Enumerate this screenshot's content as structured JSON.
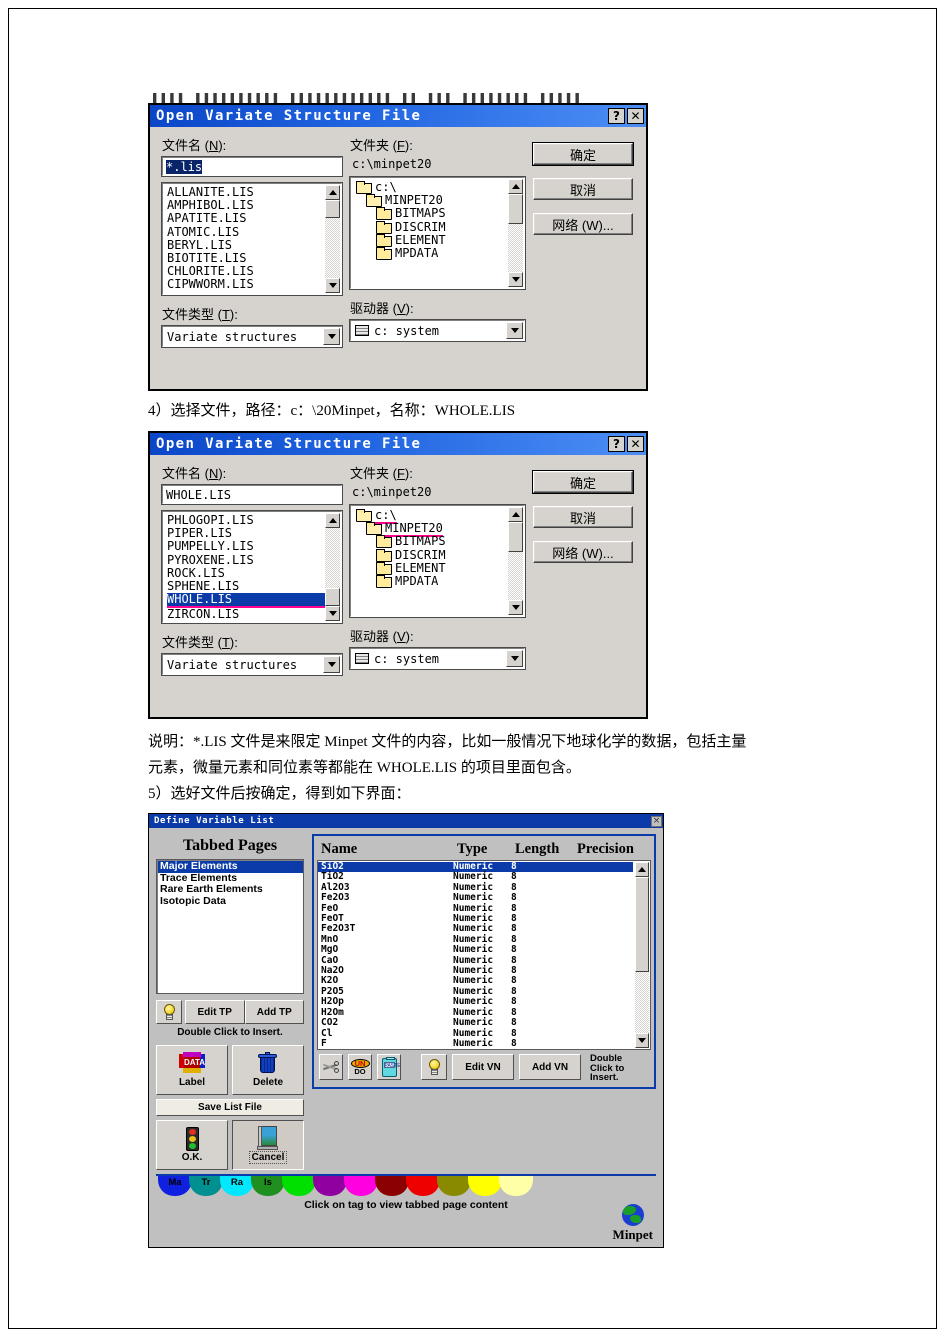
{
  "document": {
    "para_step4": "4）选择文件，路径：c：\\20Minpet，名称：WHOLE.LIS",
    "para_note_line1": "说明：*.LIS 文件是来限定 Minpet 文件的内容，比如一般情况下地球化学的数据，包括主量",
    "para_note_line2": "元素，微量元素和同位素等都能在 WHOLE.LIS 的项目里面包含。",
    "para_step5": "5）选好文件后按确定，得到如下界面："
  },
  "dialog1": {
    "title": "Open Variate Structure File",
    "help_btn": "?",
    "close_btn": "✕",
    "filename_label": "文件名 (N):",
    "filename_mnemonic": "N",
    "filename_value": "*.lis",
    "folder_label": "文件夹 (F):",
    "folder_path": "c:\\minpet20",
    "filetype_label": "文件类型 (T):",
    "filetype_value": "Variate structures",
    "drive_label": "驱动器 (V):",
    "drive_value": "c: system",
    "ok_button": "确定",
    "cancel_button": "取消",
    "network_button": "网络 (W)...",
    "files": [
      "ALLANITE.LIS",
      "AMPHIBOL.LIS",
      "APATITE.LIS",
      "ATOMIC.LIS",
      "BERYL.LIS",
      "BIOTITE.LIS",
      "CHLORITE.LIS",
      "CIPWWORM.LIS"
    ],
    "selected_file": null,
    "folders": [
      {
        "label": "c:\\",
        "indent": 0,
        "type": "open-root",
        "underline": false
      },
      {
        "label": "MINPET20",
        "indent": 1,
        "type": "open",
        "underline": false
      },
      {
        "label": "BITMAPS",
        "indent": 2,
        "type": "closed",
        "underline": false
      },
      {
        "label": "DISCRIM",
        "indent": 2,
        "type": "closed",
        "underline": false
      },
      {
        "label": "ELEMENT",
        "indent": 2,
        "type": "closed",
        "underline": false
      },
      {
        "label": "MPDATA",
        "indent": 2,
        "type": "closed",
        "underline": false
      }
    ]
  },
  "dialog2": {
    "title": "Open Variate Structure File",
    "help_btn": "?",
    "close_btn": "✕",
    "filename_label": "文件名 (N):",
    "filename_value": "WHOLE.LIS",
    "folder_label": "文件夹 (F):",
    "folder_path": "c:\\minpet20",
    "filetype_label": "文件类型 (T):",
    "filetype_value": "Variate structures",
    "drive_label": "驱动器 (V):",
    "drive_value": "c: system",
    "ok_button": "确定",
    "cancel_button": "取消",
    "network_button": "网络 (W)...",
    "files": [
      "PHLOGOPI.LIS",
      "PIPER.LIS",
      "PUMPELLY.LIS",
      "PYROXENE.LIS",
      "ROCK.LIS",
      "SPHENE.LIS",
      "WHOLE.LIS",
      "ZIRCON.LIS"
    ],
    "selected_file": "WHOLE.LIS",
    "folders": [
      {
        "label": "c:\\",
        "indent": 0,
        "type": "open-root",
        "underline": true
      },
      {
        "label": "MINPET20",
        "indent": 1,
        "type": "open",
        "underline": true
      },
      {
        "label": "BITMAPS",
        "indent": 2,
        "type": "closed",
        "underline": false
      },
      {
        "label": "DISCRIM",
        "indent": 2,
        "type": "closed",
        "underline": false
      },
      {
        "label": "ELEMENT",
        "indent": 2,
        "type": "closed",
        "underline": false
      },
      {
        "label": "MPDATA",
        "indent": 2,
        "type": "closed",
        "underline": false
      }
    ]
  },
  "dialog3": {
    "title": "Define Variable List",
    "close_btn": "×",
    "tabbed_pages_heading": "Tabbed Pages",
    "tabbed_pages": [
      "Major Elements",
      "Trace Elements",
      "Rare Earth Elements",
      "Isotopic Data"
    ],
    "selected_tabbed_page": "Major Elements",
    "edit_tp_button": "Edit TP",
    "add_tp_button": "Add TP",
    "tp_hint": "Double Click to Insert.",
    "label_button": "Label",
    "delete_button": "Delete",
    "save_list_file_button": "Save List File",
    "ok_button": "O.K.",
    "cancel_button": "Cancel",
    "grid_headers": {
      "name": "Name",
      "type": "Type",
      "length": "Length",
      "precision": "Precision"
    },
    "variables": [
      {
        "name": "SiO2",
        "type": "Numeric",
        "length": "8",
        "precision": ""
      },
      {
        "name": "TiO2",
        "type": "Numeric",
        "length": "8",
        "precision": ""
      },
      {
        "name": "Al2O3",
        "type": "Numeric",
        "length": "8",
        "precision": ""
      },
      {
        "name": "Fe2O3",
        "type": "Numeric",
        "length": "8",
        "precision": ""
      },
      {
        "name": "FeO",
        "type": "Numeric",
        "length": "8",
        "precision": ""
      },
      {
        "name": "FeOT",
        "type": "Numeric",
        "length": "8",
        "precision": ""
      },
      {
        "name": "Fe2O3T",
        "type": "Numeric",
        "length": "8",
        "precision": ""
      },
      {
        "name": "MnO",
        "type": "Numeric",
        "length": "8",
        "precision": ""
      },
      {
        "name": "MgO",
        "type": "Numeric",
        "length": "8",
        "precision": ""
      },
      {
        "name": "CaO",
        "type": "Numeric",
        "length": "8",
        "precision": ""
      },
      {
        "name": "Na2O",
        "type": "Numeric",
        "length": "8",
        "precision": ""
      },
      {
        "name": "K2O",
        "type": "Numeric",
        "length": "8",
        "precision": ""
      },
      {
        "name": "P2O5",
        "type": "Numeric",
        "length": "8",
        "precision": ""
      },
      {
        "name": "H2Op",
        "type": "Numeric",
        "length": "8",
        "precision": ""
      },
      {
        "name": "H2Om",
        "type": "Numeric",
        "length": "8",
        "precision": ""
      },
      {
        "name": "CO2",
        "type": "Numeric",
        "length": "8",
        "precision": ""
      },
      {
        "name": "Cl",
        "type": "Numeric",
        "length": "8",
        "precision": ""
      },
      {
        "name": "F",
        "type": "Numeric",
        "length": "8",
        "precision": ""
      }
    ],
    "selected_variable": "SiO2",
    "cut_button_icon": "scissors-icon",
    "undo_button_label": "UNDO",
    "paste_button_label": "PASTE",
    "edit_vn_button": "Edit VN",
    "add_vn_button": "Add VN",
    "vn_hint": "Double Click to Insert.",
    "tag_note": "Click on tag to view tabbed page content",
    "brand": "Minpet",
    "tags": [
      {
        "label": "Ma",
        "color": "#1020e0"
      },
      {
        "label": "Tr",
        "color": "#009090"
      },
      {
        "label": "Ra",
        "color": "#00e8ff"
      },
      {
        "label": "Is",
        "color": "#1f9020"
      },
      {
        "label": "",
        "color": "#00e000"
      },
      {
        "label": "",
        "color": "#9000a0"
      },
      {
        "label": "",
        "color": "#ff00e0"
      },
      {
        "label": "",
        "color": "#8b0000"
      },
      {
        "label": "",
        "color": "#ee0000"
      },
      {
        "label": "",
        "color": "#8a8a00"
      },
      {
        "label": "",
        "color": "#ffff00"
      },
      {
        "label": "",
        "color": "#ffffa8"
      }
    ]
  }
}
